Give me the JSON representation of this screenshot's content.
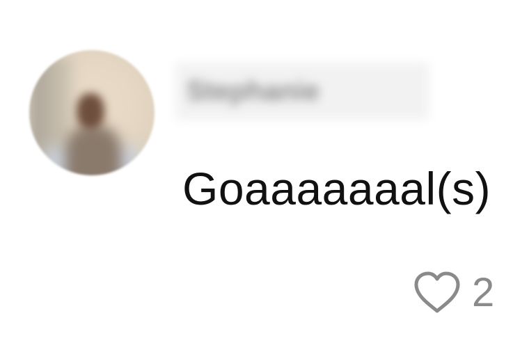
{
  "comment": {
    "username": "Stephanie",
    "text": "Goaaaaaaal(s)",
    "like_count": "2"
  },
  "icons": {
    "like": "heart-outline-icon"
  },
  "colors": {
    "text": "#111111",
    "meta": "#8a8a8a",
    "background": "#ffffff"
  }
}
